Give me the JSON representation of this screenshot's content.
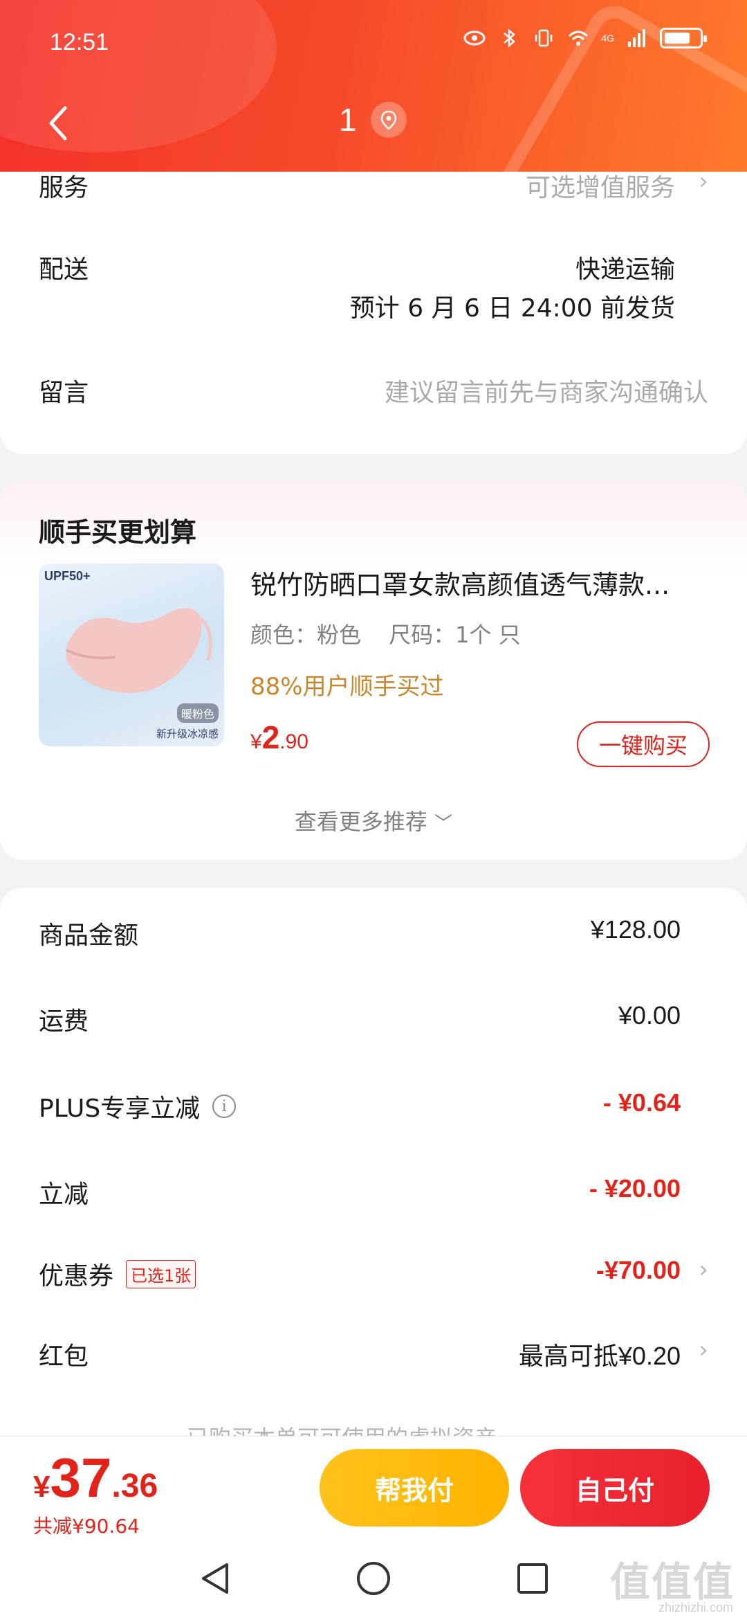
{
  "status_bar": {
    "time": "12:51",
    "network": "4G"
  },
  "header": {
    "title": "1"
  },
  "order_info": {
    "service_label": "服务",
    "service_value": "可选增值服务",
    "delivery_label": "配送",
    "delivery_method": "快递运输",
    "delivery_estimate": "预计 6 月 6 日 24:00 前发货",
    "message_label": "留言",
    "message_placeholder": "建议留言前先与商家沟通确认"
  },
  "recommend": {
    "title": "顺手买更划算",
    "product": {
      "image_text_upf": "UPF50+",
      "image_tag_color": "暖粉色",
      "image_tag_desc": "新升级冰凉感",
      "name": "锐竹防晒口罩女款高颜值透气薄款...",
      "spec_color": "颜色：粉色",
      "spec_size": "尺码：1个 只",
      "bought_hint": "88%用户顺手买过",
      "price_currency": "¥",
      "price_int": "2",
      "price_dec": ".90",
      "buy_button": "一键购买"
    },
    "more_label": "查看更多推荐"
  },
  "fees": {
    "goods_label": "商品金额",
    "goods_amount": "¥128.00",
    "shipping_label": "运费",
    "shipping_amount": "¥0.00",
    "plus_label": "PLUS专享立减",
    "plus_amount": "- ¥0.64",
    "discount_label": "立减",
    "discount_amount": "- ¥20.00",
    "coupon_label": "优惠券",
    "coupon_tag": "已选1张",
    "coupon_amount": "-¥70.00",
    "redpacket_label": "红包",
    "redpacket_amount": "最高可抵¥0.20",
    "partial_text": "已购买本单可可使用的虚拟资产"
  },
  "bottom": {
    "total_currency": "¥",
    "total_int": "37",
    "total_dec": ".36",
    "saved": "共减¥90.64",
    "help_pay": "帮我付",
    "self_pay": "自己付"
  },
  "watermark": {
    "main": "值值值",
    "sub": "zhizhizhi.com"
  },
  "colors": {
    "accent_red": "#e2231a",
    "header_start": "#f4312a",
    "header_end": "#ff7a2b",
    "help_yellow": "#ffb300"
  }
}
